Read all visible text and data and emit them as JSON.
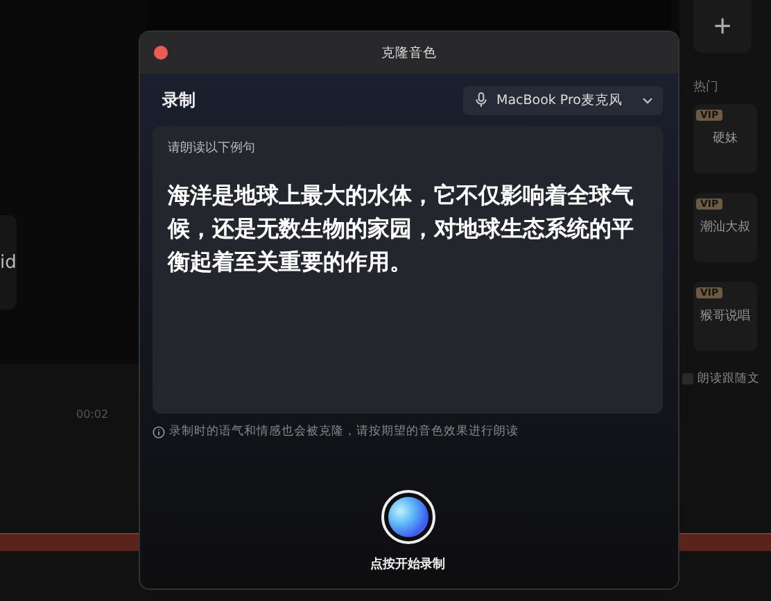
{
  "background": {
    "left_label": "id",
    "add_symbol": "+",
    "section_label": "热门",
    "voices": [
      {
        "badge": "VIP",
        "name": "硬妹"
      },
      {
        "badge": "VIP",
        "name": "潮汕大叔"
      },
      {
        "badge": "VIP",
        "name": "猴哥说唱"
      }
    ],
    "follow_text": {
      "label": "朗读跟随文",
      "checked": false
    },
    "timecode": "00:02"
  },
  "dialog": {
    "title": "克隆音色",
    "section": "录制",
    "microphone": "MacBook Pro麦克风",
    "prompt": "请朗读以下例句",
    "sentence": "海洋是地球上最大的水体，它不仅影响着全球气候，还是无数生物的家园，对地球生态系统的平衡起着至关重要的作用。",
    "hint": "录制时的语气和情感也会被克隆，请按期望的音色效果进行朗读",
    "record_label": "点按开始录制"
  }
}
